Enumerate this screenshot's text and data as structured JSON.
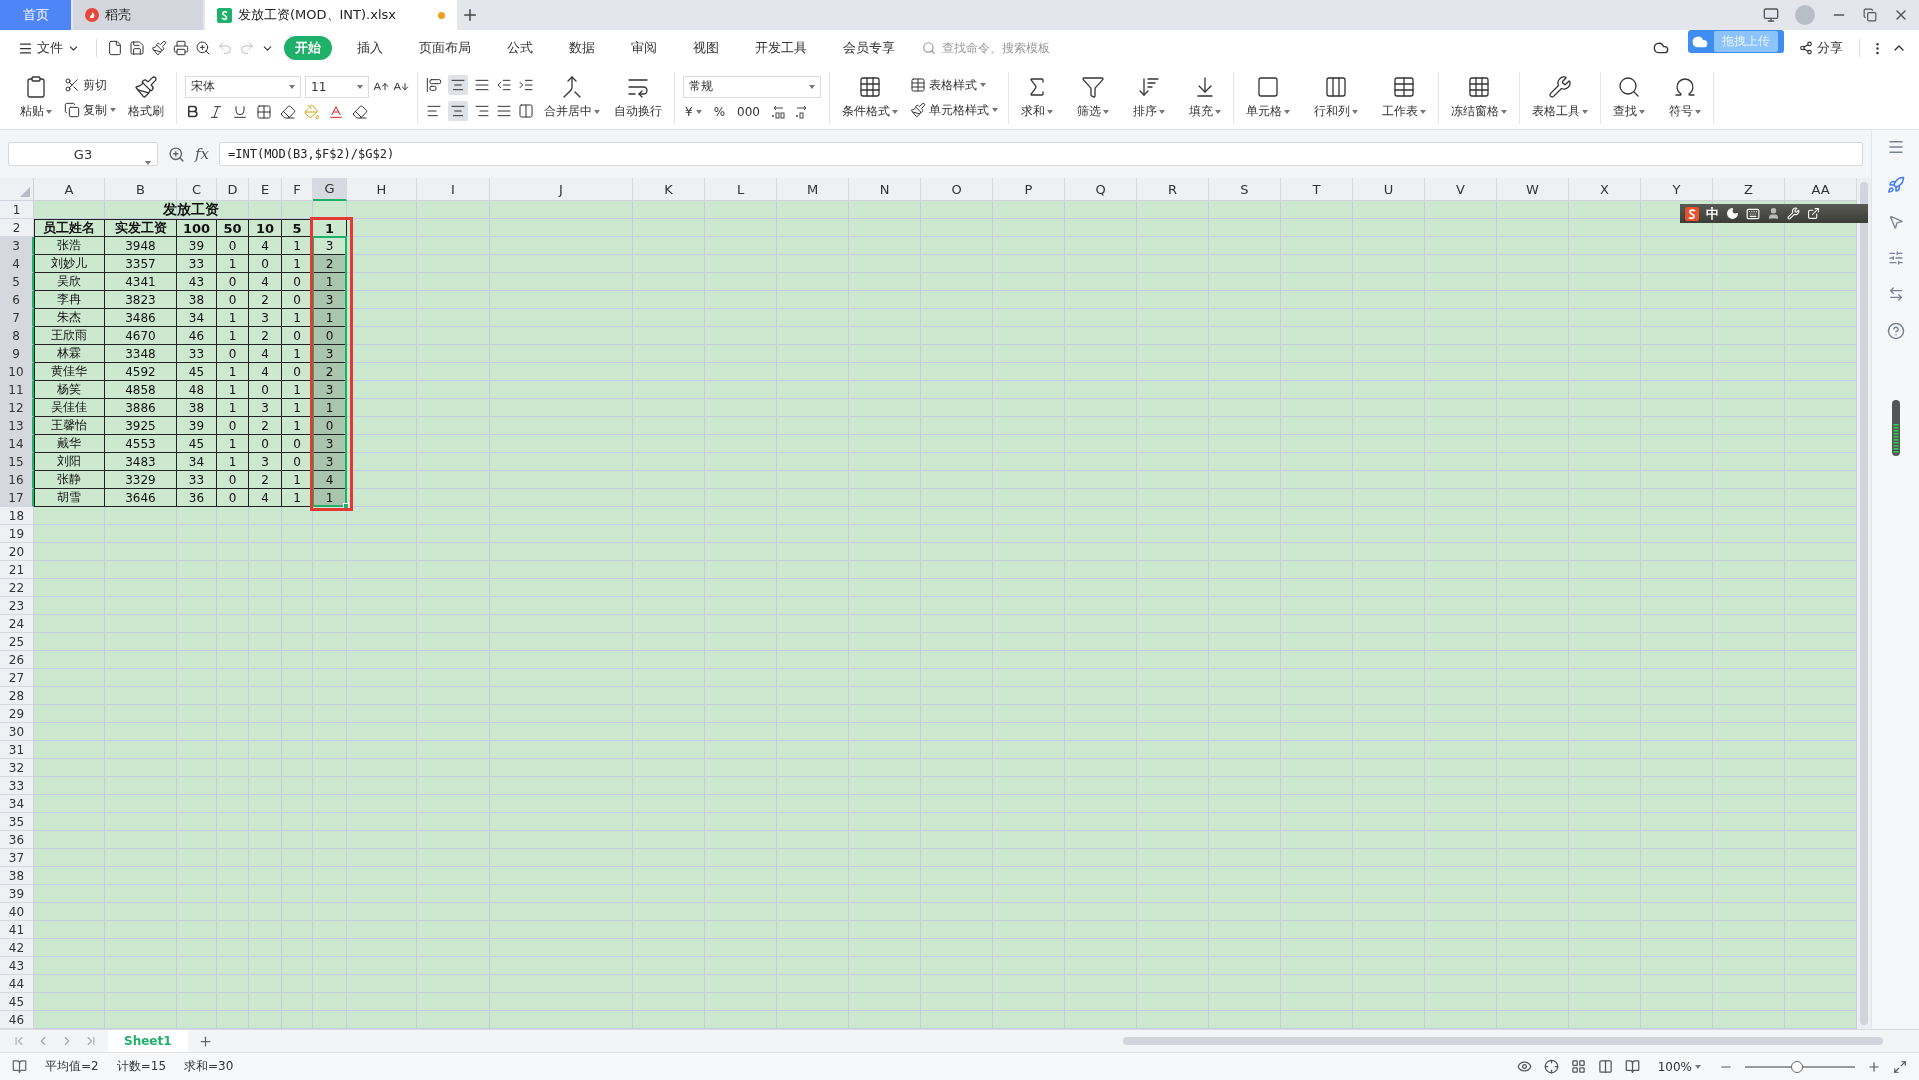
{
  "app_tabs": [
    {
      "kind": "home",
      "label": "首页",
      "selected": false
    },
    {
      "kind": "docer",
      "label": "稻壳",
      "selected": false
    },
    {
      "kind": "file",
      "label": "发放工资(MOD、INT).xlsx",
      "selected": true,
      "modified": true
    }
  ],
  "menu": {
    "file": "文件",
    "tabs": [
      {
        "label": "开始",
        "selected": true
      },
      {
        "label": "插入",
        "selected": false
      },
      {
        "label": "页面布局",
        "selected": false
      },
      {
        "label": "公式",
        "selected": false
      },
      {
        "label": "数据",
        "selected": false
      },
      {
        "label": "审阅",
        "selected": false
      },
      {
        "label": "视图",
        "selected": false
      },
      {
        "label": "开发工具",
        "selected": false
      },
      {
        "label": "会员专享",
        "selected": false
      }
    ],
    "search": {
      "placeholder": "查找命令、搜索模板"
    },
    "share": "分享",
    "upload_badge": "拖拽上传"
  },
  "ribbon": {
    "paste": "粘贴",
    "cut": "剪切",
    "copy": "复制",
    "format_painter": "格式刷",
    "font_name": "宋体",
    "font_size": "11",
    "merge": "合并居中",
    "wrap": "自动换行",
    "number_format": "常规",
    "currency": "¥",
    "percent": "%",
    "thousands": "000",
    "conditional": "条件格式",
    "table_style": "表格样式",
    "cell_style": "单元格样式",
    "tools": [
      {
        "label": "求和"
      },
      {
        "label": "筛选"
      },
      {
        "label": "排序"
      },
      {
        "label": "填充"
      },
      {
        "label": "单元格"
      },
      {
        "label": "行和列"
      },
      {
        "label": "工作表"
      },
      {
        "label": "冻结窗格"
      },
      {
        "label": "表格工具"
      },
      {
        "label": "查找"
      },
      {
        "label": "符号"
      }
    ]
  },
  "formula_bar": {
    "cell": "G3",
    "fx": "fx",
    "formula": "=INT(MOD(B3,$F$2)/$G$2)"
  },
  "sheet": {
    "columns": [
      {
        "label": "A",
        "selected": false
      },
      {
        "label": "B",
        "selected": false
      },
      {
        "label": "C",
        "selected": false
      },
      {
        "label": "D",
        "selected": false
      },
      {
        "label": "E",
        "selected": false
      },
      {
        "label": "F",
        "selected": false
      },
      {
        "label": "G",
        "selected": true
      },
      {
        "label": "H",
        "selected": false
      },
      {
        "label": "I",
        "selected": false
      },
      {
        "label": "J",
        "selected": false
      },
      {
        "label": "K",
        "selected": false
      },
      {
        "label": "L",
        "selected": false
      },
      {
        "label": "M",
        "selected": false
      },
      {
        "label": "N",
        "selected": false
      },
      {
        "label": "O",
        "selected": false
      },
      {
        "label": "P",
        "selected": false
      },
      {
        "label": "Q",
        "selected": false
      },
      {
        "label": "R",
        "selected": false
      },
      {
        "label": "S",
        "selected": false
      },
      {
        "label": "T",
        "selected": false
      },
      {
        "label": "U",
        "selected": false
      },
      {
        "label": "V",
        "selected": false
      },
      {
        "label": "W",
        "selected": false
      },
      {
        "label": "X",
        "selected": false
      },
      {
        "label": "Y",
        "selected": false
      },
      {
        "label": "Z",
        "selected": false
      },
      {
        "label": "AA",
        "selected": false
      }
    ],
    "rows": [
      {
        "label": "1",
        "kind": "title",
        "selected": false,
        "cells": [
          "发放工资"
        ]
      },
      {
        "label": "2",
        "kind": "header",
        "selected": false,
        "cells": [
          "员工姓名",
          "实发工资",
          "100",
          "50",
          "10",
          "5",
          "1"
        ]
      },
      {
        "label": "3",
        "kind": "data",
        "selected": true,
        "active": true,
        "cells": [
          "张浩",
          "3948",
          "39",
          "0",
          "4",
          "1",
          "3"
        ]
      },
      {
        "label": "4",
        "kind": "data",
        "selected": true,
        "active": false,
        "cells": [
          "刘妙儿",
          "3357",
          "33",
          "1",
          "0",
          "1",
          "2"
        ]
      },
      {
        "label": "5",
        "kind": "data",
        "selected": true,
        "active": false,
        "cells": [
          "吴欣",
          "4341",
          "43",
          "0",
          "4",
          "0",
          "1"
        ]
      },
      {
        "label": "6",
        "kind": "data",
        "selected": true,
        "active": false,
        "cells": [
          "李冉",
          "3823",
          "38",
          "0",
          "2",
          "0",
          "3"
        ]
      },
      {
        "label": "7",
        "kind": "data",
        "selected": true,
        "active": false,
        "cells": [
          "朱杰",
          "3486",
          "34",
          "1",
          "3",
          "1",
          "1"
        ]
      },
      {
        "label": "8",
        "kind": "data",
        "selected": true,
        "active": false,
        "cells": [
          "王欣雨",
          "4670",
          "46",
          "1",
          "2",
          "0",
          "0"
        ]
      },
      {
        "label": "9",
        "kind": "data",
        "selected": true,
        "active": false,
        "cells": [
          "林霖",
          "3348",
          "33",
          "0",
          "4",
          "1",
          "3"
        ]
      },
      {
        "label": "10",
        "kind": "data",
        "selected": true,
        "active": false,
        "cells": [
          "黄佳华",
          "4592",
          "45",
          "1",
          "4",
          "0",
          "2"
        ]
      },
      {
        "label": "11",
        "kind": "data",
        "selected": true,
        "active": false,
        "cells": [
          "杨笑",
          "4858",
          "48",
          "1",
          "0",
          "1",
          "3"
        ]
      },
      {
        "label": "12",
        "kind": "data",
        "selected": true,
        "active": false,
        "cells": [
          "吴佳佳",
          "3886",
          "38",
          "1",
          "3",
          "1",
          "1"
        ]
      },
      {
        "label": "13",
        "kind": "data",
        "selected": true,
        "active": false,
        "cells": [
          "王馨怡",
          "3925",
          "39",
          "0",
          "2",
          "1",
          "0"
        ]
      },
      {
        "label": "14",
        "kind": "data",
        "selected": true,
        "active": false,
        "cells": [
          "戴华",
          "4553",
          "45",
          "1",
          "0",
          "0",
          "3"
        ]
      },
      {
        "label": "15",
        "kind": "data",
        "selected": true,
        "active": false,
        "cells": [
          "刘阳",
          "3483",
          "34",
          "1",
          "3",
          "0",
          "3"
        ]
      },
      {
        "label": "16",
        "kind": "data",
        "selected": true,
        "active": false,
        "cells": [
          "张静",
          "3329",
          "33",
          "0",
          "2",
          "1",
          "4"
        ]
      },
      {
        "label": "17",
        "kind": "data",
        "selected": true,
        "active": false,
        "cells": [
          "胡雪",
          "3646",
          "36",
          "0",
          "4",
          "1",
          "1"
        ]
      },
      {
        "label": "18",
        "kind": "empty",
        "selected": false
      },
      {
        "label": "19",
        "kind": "empty",
        "selected": false
      },
      {
        "label": "20",
        "kind": "empty",
        "selected": false
      },
      {
        "label": "21",
        "kind": "empty",
        "selected": false
      },
      {
        "label": "22",
        "kind": "empty",
        "selected": false
      },
      {
        "label": "23",
        "kind": "empty",
        "selected": false
      },
      {
        "label": "24",
        "kind": "empty",
        "selected": false
      },
      {
        "label": "25",
        "kind": "empty",
        "selected": false
      },
      {
        "label": "26",
        "kind": "empty",
        "selected": false
      },
      {
        "label": "27",
        "kind": "empty",
        "selected": false
      },
      {
        "label": "28",
        "kind": "empty",
        "selected": false
      },
      {
        "label": "29",
        "kind": "empty",
        "selected": false
      },
      {
        "label": "30",
        "kind": "empty",
        "selected": false
      },
      {
        "label": "31",
        "kind": "empty",
        "selected": false
      },
      {
        "label": "32",
        "kind": "empty",
        "selected": false
      },
      {
        "label": "33",
        "kind": "empty",
        "selected": false
      },
      {
        "label": "34",
        "kind": "empty",
        "selected": false
      },
      {
        "label": "35",
        "kind": "empty",
        "selected": false
      },
      {
        "label": "36",
        "kind": "empty",
        "selected": false
      },
      {
        "label": "37",
        "kind": "empty",
        "selected": false
      },
      {
        "label": "38",
        "kind": "empty",
        "selected": false
      },
      {
        "label": "39",
        "kind": "empty",
        "selected": false
      },
      {
        "label": "40",
        "kind": "empty",
        "selected": false
      },
      {
        "label": "41",
        "kind": "empty",
        "selected": false
      },
      {
        "label": "42",
        "kind": "empty",
        "selected": false
      },
      {
        "label": "43",
        "kind": "empty",
        "selected": false
      },
      {
        "label": "44",
        "kind": "empty",
        "selected": false
      },
      {
        "label": "45",
        "kind": "empty",
        "selected": false
      },
      {
        "label": "46",
        "kind": "empty",
        "selected": false
      }
    ],
    "annotation": {
      "kind": "frame"
    }
  },
  "ime": {
    "mode": "中"
  },
  "sheet_tabs": [
    {
      "label": "Sheet1",
      "selected": true
    }
  ],
  "status": {
    "stats": [
      "平均值=2",
      "计数=15",
      "求和=30"
    ],
    "zoom": {
      "label": "100%",
      "level": 0.47
    }
  }
}
